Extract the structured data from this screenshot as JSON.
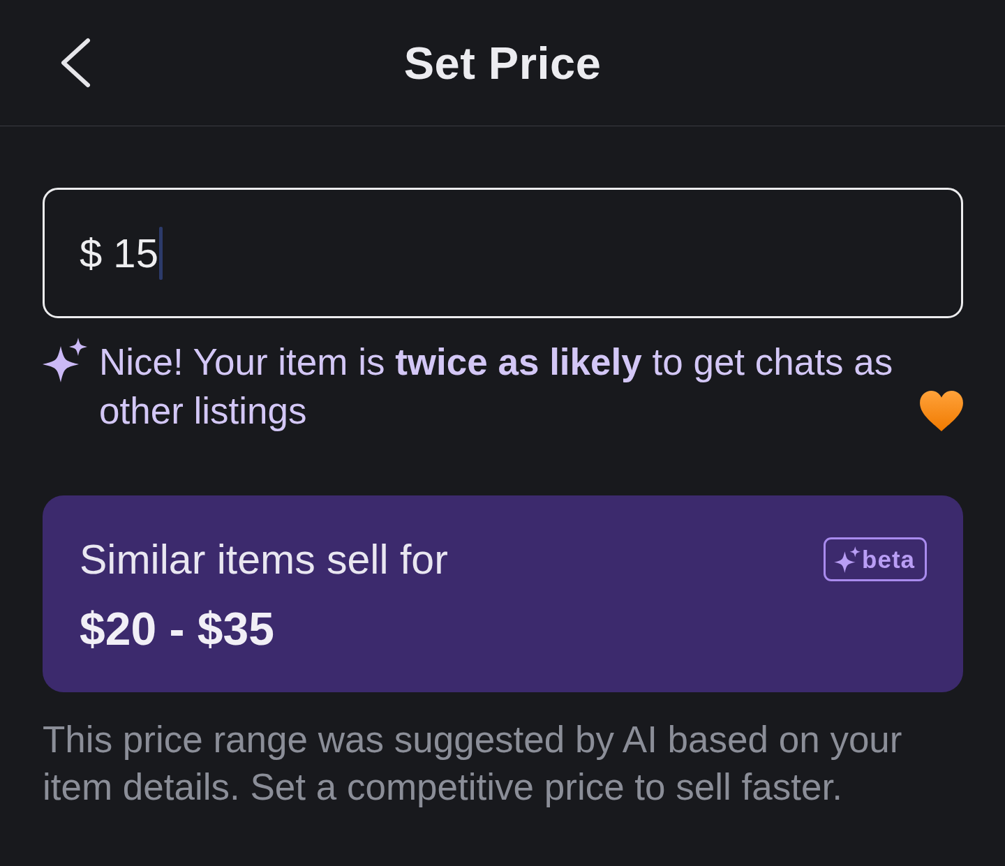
{
  "header": {
    "title": "Set Price"
  },
  "price_field": {
    "value": "$ 15",
    "focused": true
  },
  "hint": {
    "text": "Nice! Your item is **twice as likely** to get chats as other listings"
  },
  "estimate_card": {
    "title": "Similar items sell for",
    "range": "$20 - $35",
    "badge": "beta"
  },
  "footnote": "This price range was suggested by AI based on your item details. Set a competitive price to sell faster."
}
